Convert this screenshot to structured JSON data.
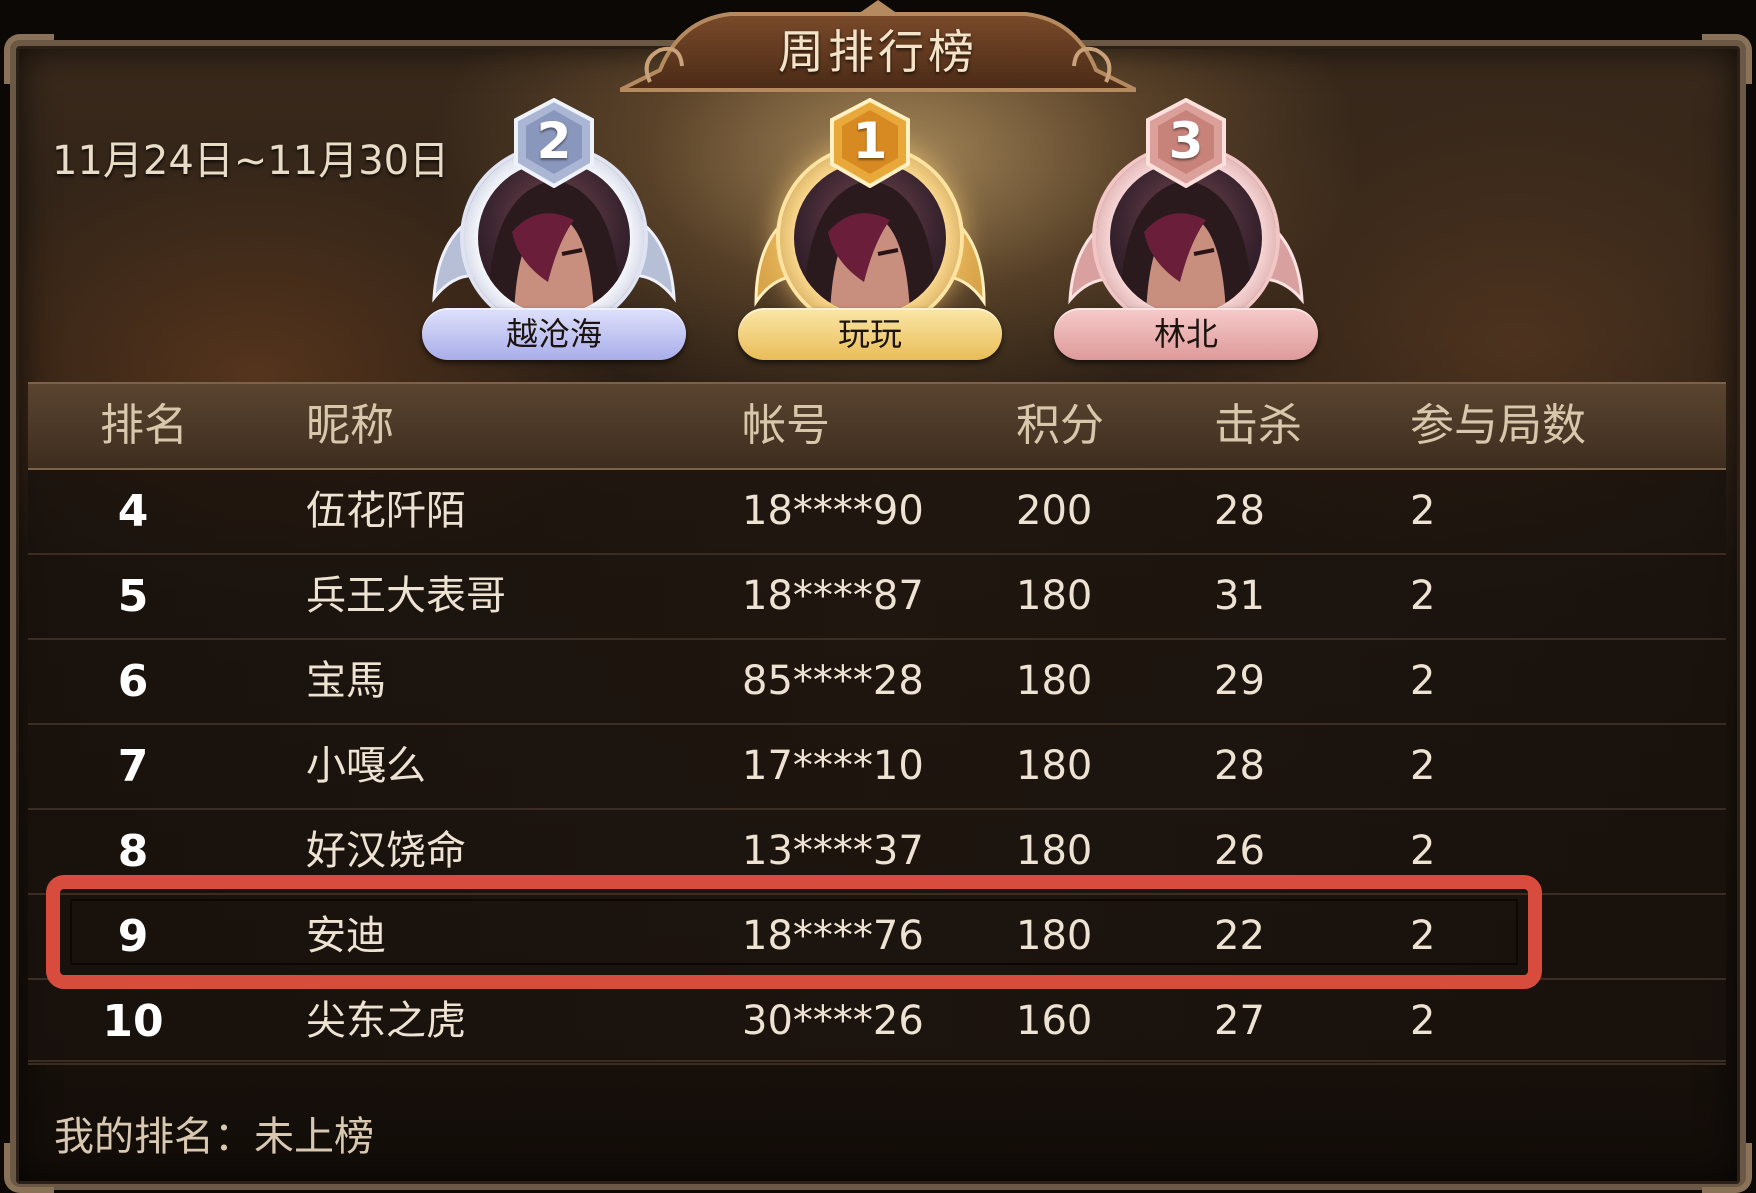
{
  "title": "周排行榜",
  "date_range": "11月24日~11月30日",
  "podium": [
    {
      "rank": "2",
      "name": "越沧海",
      "tier": "silver"
    },
    {
      "rank": "1",
      "name": "玩玩",
      "tier": "gold"
    },
    {
      "rank": "3",
      "name": "林北",
      "tier": "bronze"
    }
  ],
  "table": {
    "headers": {
      "rank": "排名",
      "nickname": "昵称",
      "account": "帐号",
      "score": "积分",
      "kills": "击杀",
      "games": "参与局数"
    },
    "rows": [
      {
        "rank": "4",
        "nickname": "伍花阡陌",
        "account": "18****90",
        "score": "200",
        "kills": "28",
        "games": "2"
      },
      {
        "rank": "5",
        "nickname": "兵王大表哥",
        "account": "18****87",
        "score": "180",
        "kills": "31",
        "games": "2"
      },
      {
        "rank": "6",
        "nickname": "宝馬",
        "account": "85****28",
        "score": "180",
        "kills": "29",
        "games": "2"
      },
      {
        "rank": "7",
        "nickname": "小嘎么",
        "account": "17****10",
        "score": "180",
        "kills": "28",
        "games": "2"
      },
      {
        "rank": "8",
        "nickname": "好汉饶命",
        "account": "13****37",
        "score": "180",
        "kills": "26",
        "games": "2"
      },
      {
        "rank": "9",
        "nickname": "安迪",
        "account": "18****76",
        "score": "180",
        "kills": "22",
        "games": "2"
      },
      {
        "rank": "10",
        "nickname": "尖东之虎",
        "account": "30****26",
        "score": "160",
        "kills": "27",
        "games": "2"
      }
    ],
    "highlighted_rank": "9"
  },
  "my_rank": "我的排名：未上榜",
  "colors": {
    "highlight": "#d84c3e",
    "gold": "#f3c86a",
    "silver": "#c9cff0",
    "bronze": "#e8a8a8"
  }
}
